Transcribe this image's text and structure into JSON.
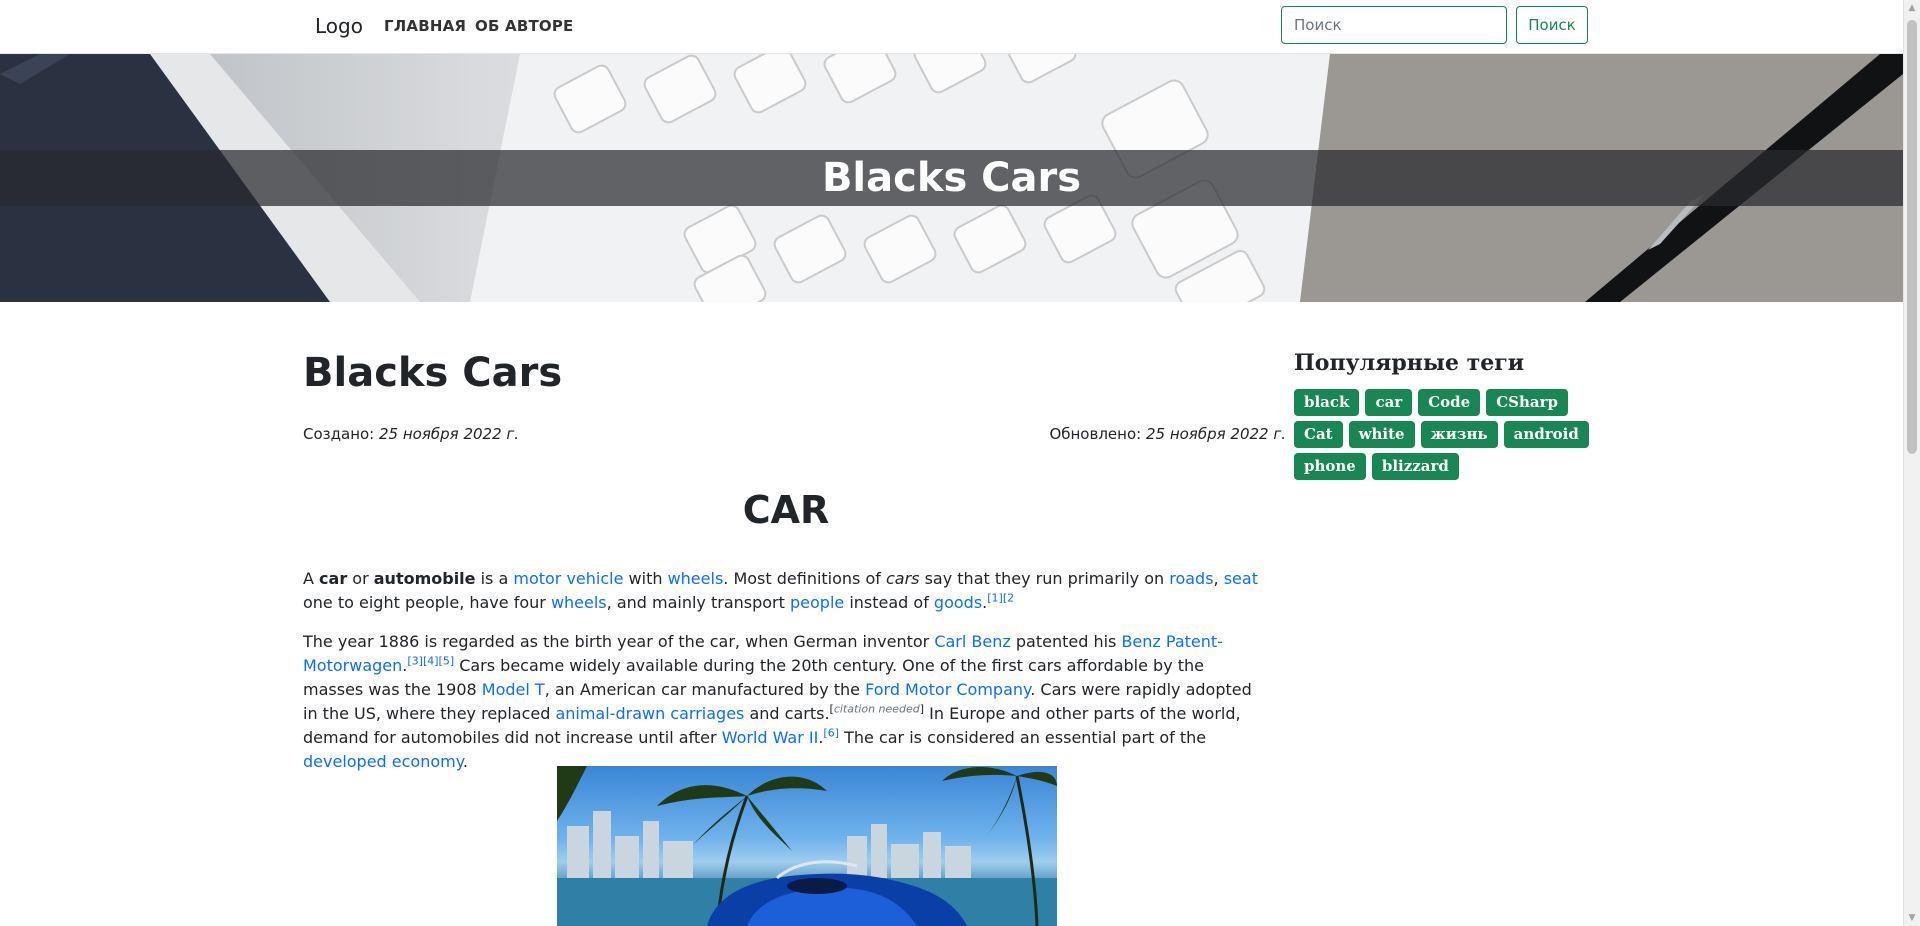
{
  "navbar": {
    "brand": "Logo",
    "links": [
      "ГЛАВНАЯ",
      "ОБ АВТОРЕ"
    ],
    "search_placeholder": "Поиск",
    "search_button": "Поиск"
  },
  "hero": {
    "title": "Blacks Cars"
  },
  "post": {
    "title": "Blacks Cars",
    "created_label": "Создано:",
    "created_date": "25 ноября 2022 г.",
    "updated_label": "Обновлено:",
    "updated_date": "25 ноября 2022 г."
  },
  "article": {
    "heading": "CAR",
    "p1": {
      "t1": "A ",
      "b1": "car",
      "t2": " or ",
      "b2": "automobile",
      "t3": " is a ",
      "l1": "motor vehicle",
      "t4": " with ",
      "l2": "wheels",
      "t5": ". Most definitions of ",
      "i1": "cars",
      "t6": " say that they run primarily on ",
      "l3": "roads",
      "t7": ", ",
      "l4": "seat",
      "t8": " one to eight people, have four ",
      "l5": "wheels",
      "t9": ", and mainly transport ",
      "l6": "people",
      "t10": " instead of ",
      "l7": "goods",
      "t11": ".",
      "s1": "[1][2"
    },
    "p2": {
      "t1": "The year 1886 is regarded as the birth year of the car, when German inventor ",
      "l1": "Carl Benz",
      "t2": " patented his ",
      "l2": "Benz Patent-Motorwagen",
      "t3": ".",
      "s1": "[3][4][5]",
      "t4": " Cars became widely available during the 20th century. One of the first cars affordable by the masses was the 1908 ",
      "l3": "Model T",
      "t5": ", an American car manufactured by the ",
      "l4": "Ford Motor Company",
      "t6": ". Cars were rapidly adopted in the US, where they replaced ",
      "l5": "animal-drawn carriages",
      "t7": " and carts.",
      "s2a": "[",
      "cite": "citation needed",
      "s2b": "]",
      "t8": " In Europe and other parts of the world, demand for automobiles did not increase until after ",
      "l6": "World War II",
      "t9": ".",
      "s3": "[6]",
      "t10": " The car is considered an essential part of the ",
      "l7": "developed economy",
      "t11": "."
    }
  },
  "sidebar": {
    "title": "Популярные теги",
    "tags": [
      "black",
      "car",
      "Code",
      "CSharp",
      "Cat",
      "white",
      "жизнь",
      "android",
      "phone",
      "blizzard"
    ]
  },
  "colors": {
    "accent": "#198754",
    "link": "#0d6efd",
    "text": "#212529"
  }
}
